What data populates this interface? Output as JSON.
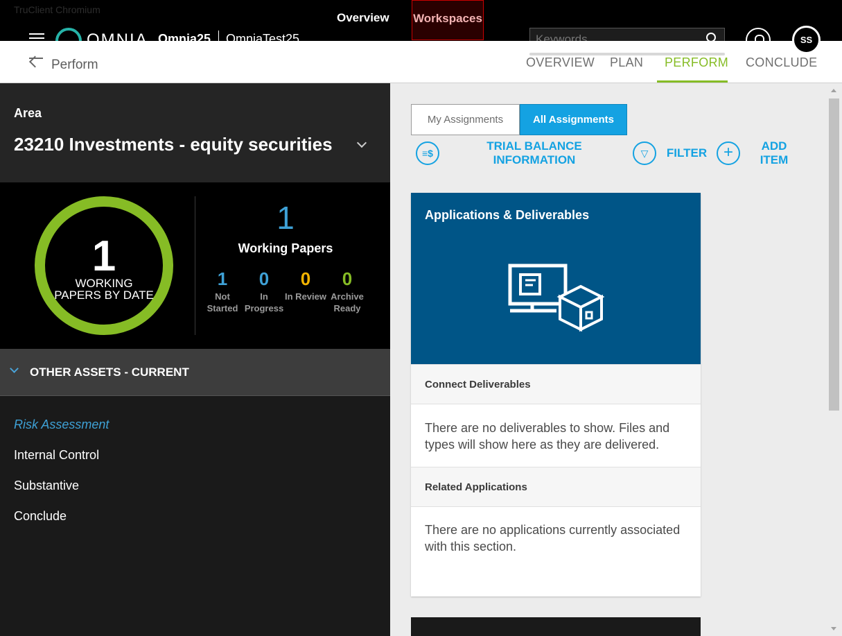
{
  "browser": {
    "title": "TruClient Chromium"
  },
  "top_nav": {
    "overview": "Overview",
    "workspaces": "Workspaces"
  },
  "brand": {
    "logo": "OMNIA",
    "engagement": "Omnia25",
    "engagement_sub": "OmniaTest25"
  },
  "search": {
    "placeholder": "Keywords",
    "icon": "search-icon"
  },
  "user": {
    "initials": "SS"
  },
  "subbar": {
    "back_label": "Perform",
    "tabs": [
      {
        "label": "OVERVIEW",
        "active": false
      },
      {
        "label": "PLAN",
        "active": false
      },
      {
        "label": "PERFORM",
        "active": true
      },
      {
        "label": "CONCLUDE",
        "active": false
      }
    ]
  },
  "area": {
    "label": "Area",
    "value": "23210 Investments - equity securities"
  },
  "stats": {
    "ring_number": "1",
    "ring_label": "WORKING PAPERS BY DATE",
    "working_papers_count": "1",
    "working_papers_label": "Working Papers",
    "statuses": [
      {
        "count": "1",
        "label": "Not Started",
        "color": "#3ea1d6"
      },
      {
        "count": "0",
        "label": "In Progress",
        "color": "#3ea1d6"
      },
      {
        "count": "0",
        "label": "In Review",
        "color": "#f2b300"
      },
      {
        "count": "0",
        "label": "Archive Ready",
        "color": "#86bc25"
      }
    ]
  },
  "section": {
    "title": "OTHER ASSETS - CURRENT"
  },
  "nav": {
    "items": [
      {
        "label": "Risk Assessment",
        "active": true
      },
      {
        "label": "Internal Control",
        "active": false
      },
      {
        "label": "Substantive",
        "active": false
      },
      {
        "label": "Conclude",
        "active": false
      }
    ]
  },
  "assignments": {
    "mine": "My Assignments",
    "all": "All Assignments"
  },
  "actions": {
    "trial_balance": "TRIAL BALANCE INFORMATION",
    "filter": "FILTER",
    "add_item": "ADD ITEM"
  },
  "card": {
    "title": "Applications & Deliverables",
    "deliverables_head": "Connect Deliverables",
    "deliverables_body": "There are no deliverables to show. Files and types will show here as they are delivered.",
    "apps_head": "Related Applications",
    "apps_body": "There are no applications currently associated with this section."
  },
  "colors": {
    "accent": "#14a2e2",
    "green": "#86bc25",
    "hero": "#005587"
  }
}
